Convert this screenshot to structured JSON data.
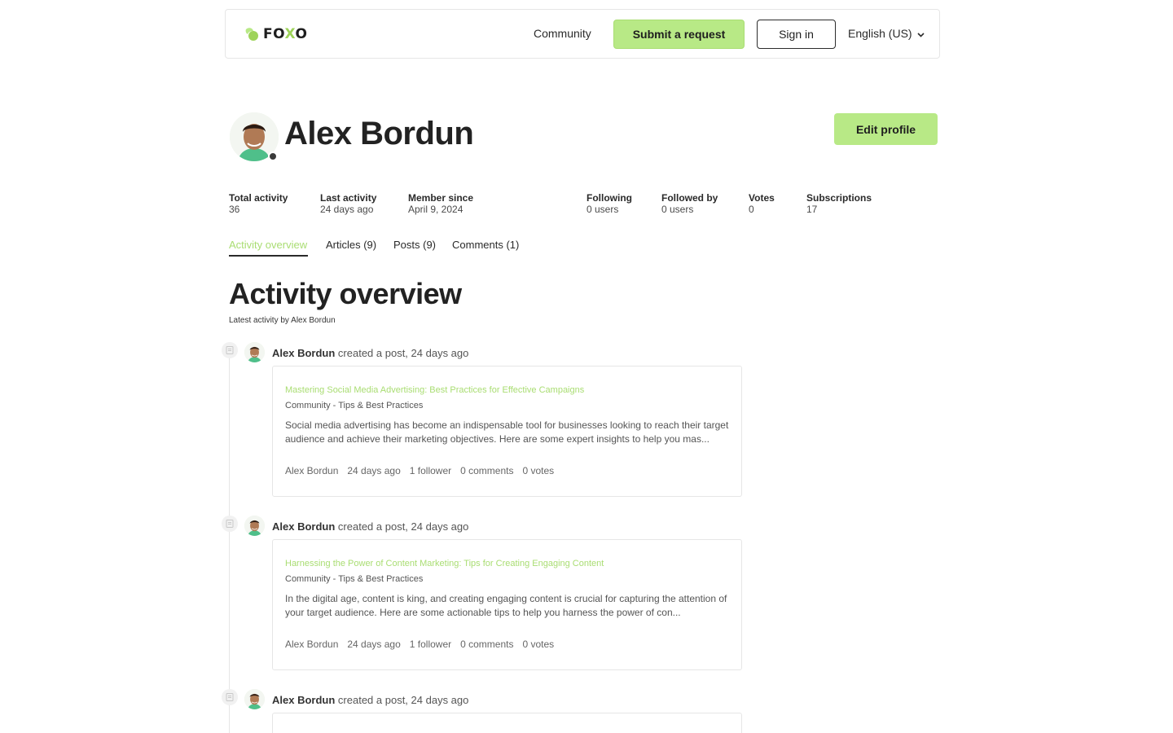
{
  "header": {
    "logo_prefix": "FO",
    "logo_x": "X",
    "logo_suffix": "O",
    "community_label": "Community",
    "submit_label": "Submit a request",
    "signin_label": "Sign in",
    "language_label": "English (US)"
  },
  "profile": {
    "name": "Alex Bordun",
    "edit_label": "Edit profile",
    "stats": [
      {
        "label": "Total activity",
        "value": "36"
      },
      {
        "label": "Last activity",
        "value": "24 days ago"
      },
      {
        "label": "Member since",
        "value": "April 9, 2024"
      },
      {
        "label": "Following",
        "value": "0 users"
      },
      {
        "label": "Followed by",
        "value": "0 users"
      },
      {
        "label": "Votes",
        "value": "0"
      },
      {
        "label": "Subscriptions",
        "value": "17"
      }
    ]
  },
  "tabs": [
    {
      "label": "Activity overview",
      "active": true
    },
    {
      "label": "Articles (9)",
      "active": false
    },
    {
      "label": "Posts (9)",
      "active": false
    },
    {
      "label": "Comments (1)",
      "active": false
    }
  ],
  "section": {
    "title": "Activity overview",
    "subtitle": "Latest activity by Alex Bordun"
  },
  "activities": [
    {
      "author": "Alex Bordun",
      "action": "created a post, 24 days ago",
      "title": "Mastering Social Media Advertising: Best Practices for Effective Campaigns",
      "category": "Community - Tips & Best Practices",
      "excerpt": "Social media advertising has become an indispensable tool for businesses looking to reach their target audience and achieve their marketing objectives. Here are some expert insights to help you mas...",
      "foot_author": "Alex Bordun",
      "foot_time": "24 days ago",
      "foot_followers": "1 follower",
      "foot_comments": "0 comments",
      "foot_votes": "0 votes"
    },
    {
      "author": "Alex Bordun",
      "action": "created a post, 24 days ago",
      "title": "Harnessing the Power of Content Marketing: Tips for Creating Engaging Content",
      "category": "Community - Tips & Best Practices",
      "excerpt": "In the digital age, content is king, and creating engaging content is crucial for capturing the attention of your target audience. Here are some actionable tips to help you harness the power of con...",
      "foot_author": "Alex Bordun",
      "foot_time": "24 days ago",
      "foot_followers": "1 follower",
      "foot_comments": "0 comments",
      "foot_votes": "0 votes"
    },
    {
      "author": "Alex Bordun",
      "action": "created a post, 24 days ago"
    }
  ],
  "colors": {
    "accent": "#b8e986",
    "accent_text": "#a9dd72",
    "text": "#2a2a2a",
    "border": "#e6e6e6"
  },
  "icons": {
    "logo": "foxo-leaf-icon",
    "language": "chevron-down-icon",
    "activity": "document-icon",
    "avatar_badge": "user-status-icon"
  }
}
